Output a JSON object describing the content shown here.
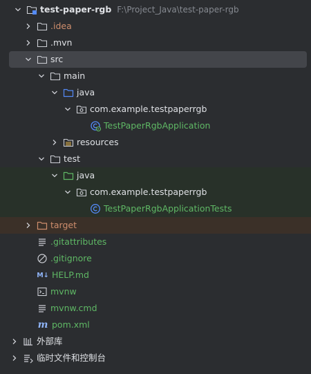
{
  "project": {
    "name": "test-paper-rgb",
    "path": "F:\\Project_Java\\test-paper-rgb"
  },
  "tree": {
    "idea": ".idea",
    "mvn": ".mvn",
    "src": "src",
    "main": "main",
    "main_java": "java",
    "main_package": "com.example.testpaperrgb",
    "main_class": "TestPaperRgbApplication",
    "resources": "resources",
    "test": "test",
    "test_java": "java",
    "test_package": "com.example.testpaperrgb",
    "test_class": "TestPaperRgbApplicationTests",
    "target": "target",
    "gitattributes": ".gitattributes",
    "gitignore": ".gitignore",
    "help_md": "HELP.md",
    "mvnw": "mvnw",
    "mvnw_cmd": "mvnw.cmd",
    "pom": "pom.xml",
    "external_libraries": "外部库",
    "scratches": "临时文件和控制台"
  },
  "icons": {
    "markdown_badge": "M↓",
    "maven_badge": "m"
  },
  "colors": {
    "background": "#2b2d30",
    "selection": "#43454a",
    "test_highlight": "#283129",
    "excluded_highlight": "#3b3028",
    "excluded_text": "#cf8e6d",
    "vcs_added_text": "#5fb865",
    "ignored_text": "#9da0a8",
    "source_folder": "#548af7",
    "test_folder": "#5fb865"
  }
}
